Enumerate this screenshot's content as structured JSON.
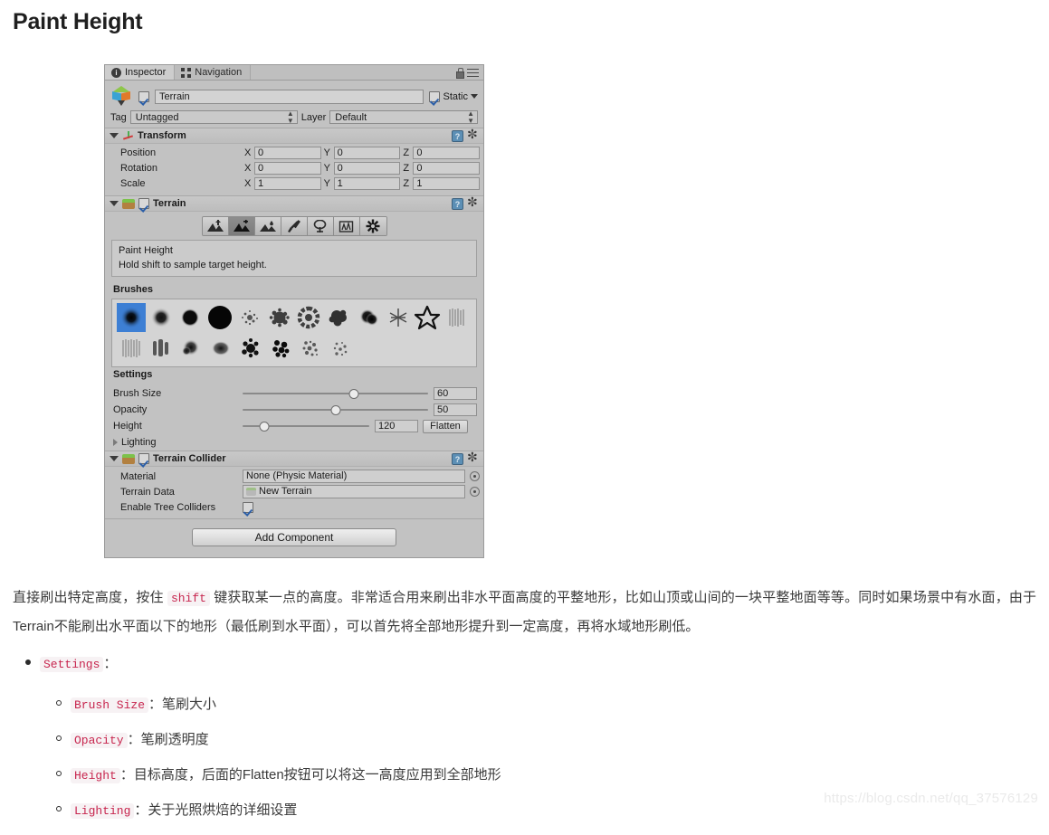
{
  "page_title": "Paint Height",
  "inspector": {
    "tabs": [
      {
        "label": "Inspector",
        "icon": "info-icon",
        "active": true
      },
      {
        "label": "Navigation",
        "icon": "navigation-icon",
        "active": false
      }
    ],
    "header_icons": [
      "lock-icon",
      "menu-icon"
    ],
    "object": {
      "enabled": true,
      "name": "Terrain",
      "static_label": "Static",
      "static_checked": true,
      "tag_label": "Tag",
      "tag_value": "Untagged",
      "layer_label": "Layer",
      "layer_value": "Default"
    },
    "transform": {
      "title": "Transform",
      "rows": [
        {
          "label": "Position",
          "x": "0",
          "y": "0",
          "z": "0"
        },
        {
          "label": "Rotation",
          "x": "0",
          "y": "0",
          "z": "0"
        },
        {
          "label": "Scale",
          "x": "1",
          "y": "1",
          "z": "1"
        }
      ],
      "axis_labels": [
        "X",
        "Y",
        "Z"
      ]
    },
    "terrain": {
      "title": "Terrain",
      "enabled": true,
      "tools": [
        {
          "name": "raise-lower-terrain-tool",
          "selected": false
        },
        {
          "name": "paint-height-tool",
          "selected": true
        },
        {
          "name": "smooth-height-tool",
          "selected": false
        },
        {
          "name": "paint-texture-tool",
          "selected": false
        },
        {
          "name": "place-trees-tool",
          "selected": false
        },
        {
          "name": "paint-details-tool",
          "selected": false
        },
        {
          "name": "terrain-settings-tool",
          "selected": false
        }
      ],
      "info_title": "Paint Height",
      "info_sub": "Hold shift to sample target height.",
      "brushes_label": "Brushes",
      "brushes_row1_count": 12,
      "brushes_row2_count": 8,
      "selected_brush_index": 0,
      "settings_label": "Settings",
      "settings": [
        {
          "label": "Brush Size",
          "value": "60",
          "slider_pct": 60
        },
        {
          "label": "Opacity",
          "value": "50",
          "slider_pct": 50
        },
        {
          "label": "Height",
          "value": "120",
          "slider_pct": 17
        }
      ],
      "flatten_label": "Flatten",
      "lighting_label": "Lighting"
    },
    "terrain_collider": {
      "title": "Terrain Collider",
      "enabled": true,
      "material_label": "Material",
      "material_value": "None (Physic Material)",
      "terrain_data_label": "Terrain Data",
      "terrain_data_value": "New Terrain",
      "tree_colliders_label": "Enable Tree Colliders",
      "tree_colliders_checked": true
    },
    "add_component_label": "Add Component"
  },
  "article": {
    "paragraph_part1": "直接刷出特定高度，按住 ",
    "paragraph_code": "shift",
    "paragraph_part2": " 键获取某一点的高度。非常适合用来刷出非水平面高度的平整地形，比如山顶或山间的一块平整地面等等。同时如果场景中有水面，由于Terrain不能刷出水平面以下的地形（最低刷到水平面），可以首先将全部地形提升到一定高度，再将水域地形刷低。",
    "top_bullet": {
      "code": "Settings",
      "text": "："
    },
    "sub_bullets": [
      {
        "code": "Brush Size",
        "text": "：笔刷大小"
      },
      {
        "code": "Opacity",
        "text": "：笔刷透明度"
      },
      {
        "code": "Height",
        "text": "：目标高度，后面的Flatten按钮可以将这一高度应用到全部地形"
      },
      {
        "code": "Lighting",
        "text": "：关于光照烘焙的详细设置"
      }
    ]
  },
  "watermark": "https://blog.csdn.net/qq_37576129"
}
